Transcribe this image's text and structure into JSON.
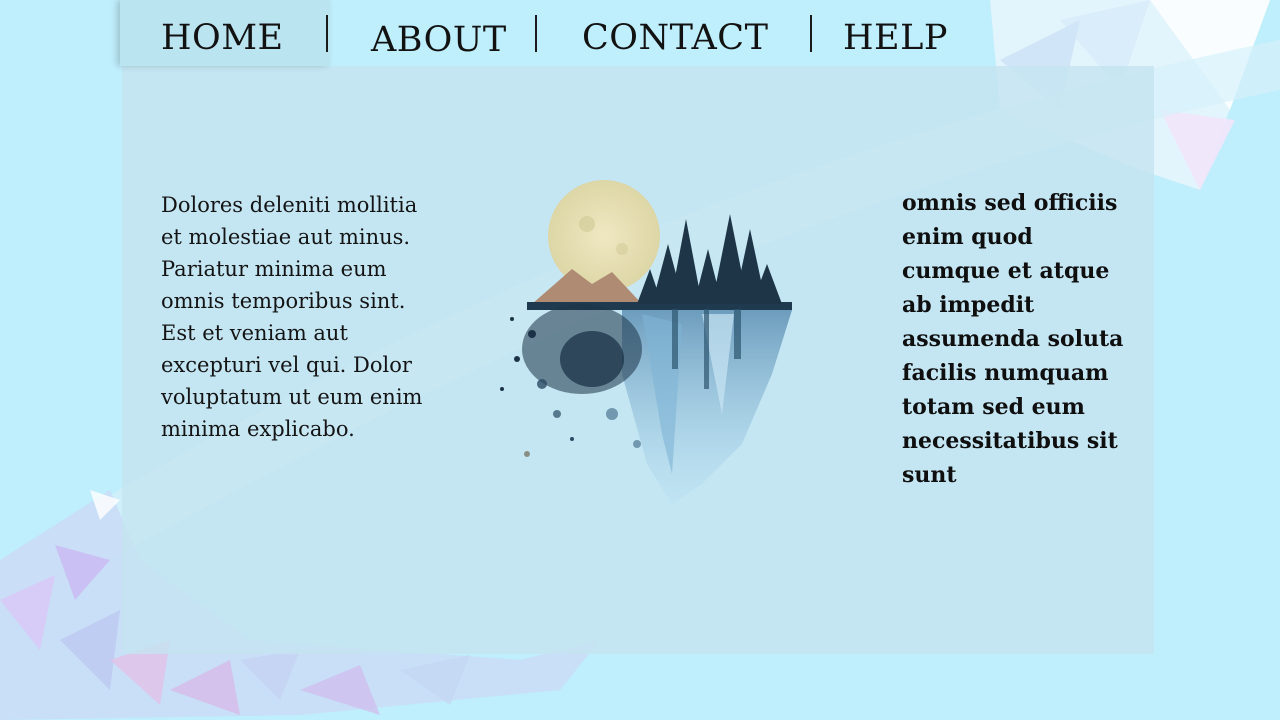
{
  "nav": {
    "items": [
      {
        "label": "HOME"
      },
      {
        "label": "ABOUT"
      },
      {
        "label": "CONTACT"
      },
      {
        "label": "HELP"
      }
    ]
  },
  "content": {
    "left_paragraph": "Dolores deleniti mollitia et molestiae aut minus. Pariatur minima eum omnis temporibus sint. Est et veniam aut excepturi vel qui. Dolor voluptatum ut eum enim minima explicabo.",
    "right_paragraph": "omnis sed officiis enim quod cumque et atque ab impedit assumenda soluta facilis numquam totam sed eum necessitatibus sit sunt"
  },
  "illustration": {
    "icon": "moon-forest-watercolor-illustration"
  },
  "colors": {
    "background": "#bfeefc",
    "panel": "#c4e4f0",
    "text": "#141414"
  }
}
